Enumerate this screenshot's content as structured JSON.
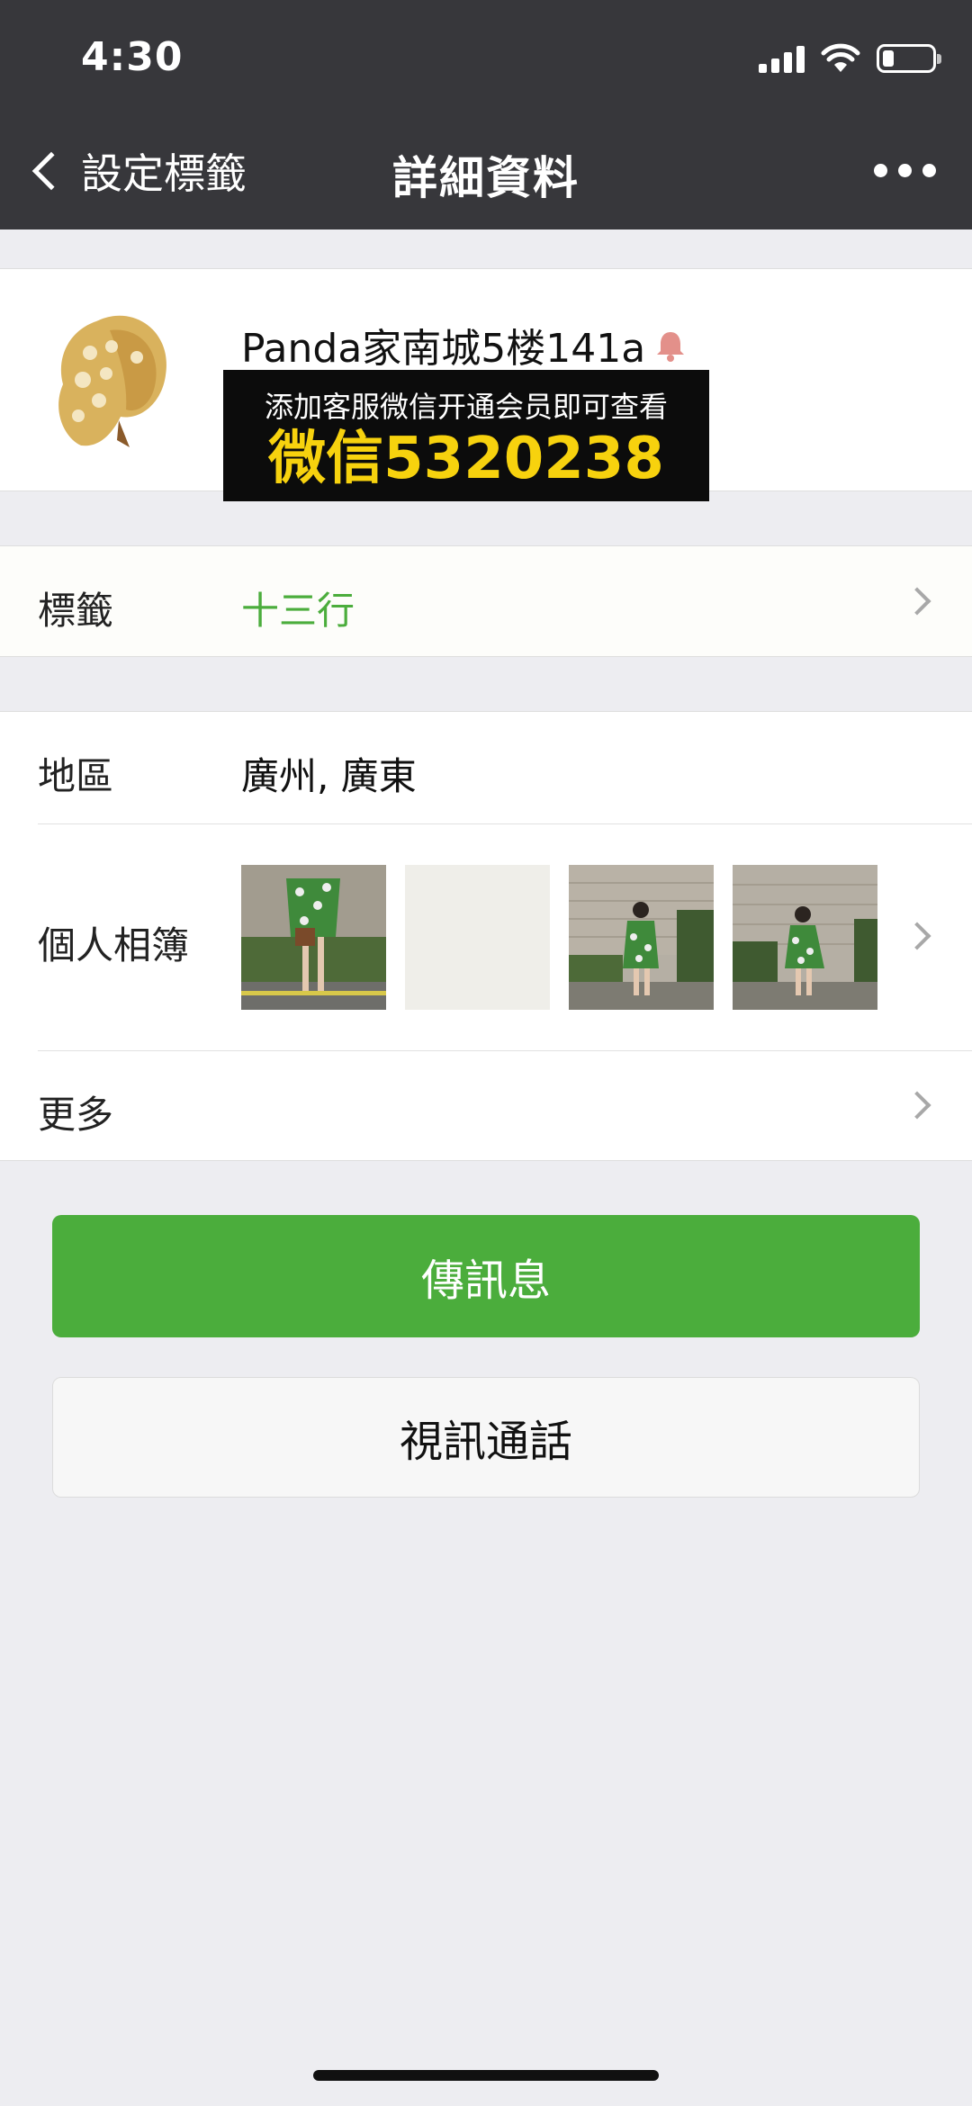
{
  "status_bar": {
    "time": "4:30"
  },
  "nav": {
    "back_label": "設定標籤",
    "title": "詳細資料"
  },
  "profile": {
    "name": "Panda家南城5楼141a"
  },
  "promo": {
    "line1": "添加客服微信开通会员即可查看",
    "line2": "微信5320238"
  },
  "tag_row": {
    "label": "標籤",
    "value": "十三行",
    "value_color": "#4bad3c"
  },
  "region_row": {
    "label": "地區",
    "value": "廣州, 廣東"
  },
  "album_row": {
    "label": "個人相簿"
  },
  "more_row": {
    "label": "更多"
  },
  "buttons": {
    "message": "傳訊息",
    "video_call": "視訊通話"
  },
  "colors": {
    "nav_bg": "#37373b",
    "primary_green": "#4bad3c",
    "promo_yellow": "#f7d20e"
  }
}
